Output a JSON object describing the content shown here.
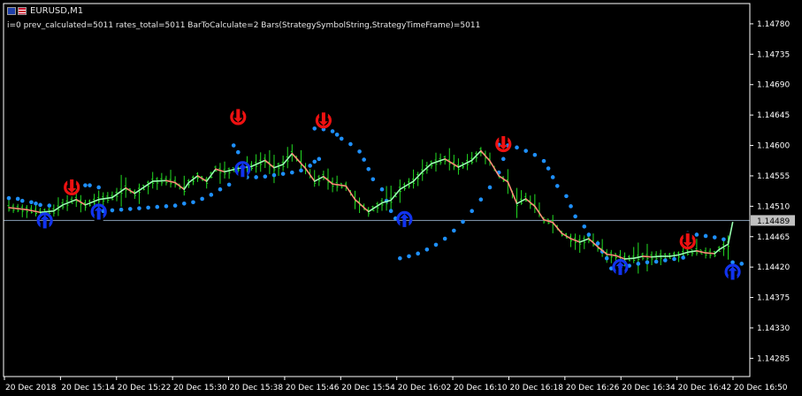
{
  "window": {
    "symbol_title": "EURUSD,M1",
    "info_line": "i=0 prev_calculated=5011 rates_total=5011 BarToCalculate=2 Bars(StrategySymbolString,StrategyTimeFrame)=5011"
  },
  "colors": {
    "background": "#000000",
    "axis": "#ffffff",
    "candle": "#22dd22",
    "line_up": "#98ffb0",
    "line_down": "#fa8f77",
    "dots": "#1e90ff",
    "arrow_down": "#ee1111",
    "arrow_up": "#1133ee",
    "price_line": "#8aa0b8",
    "price_tag_bg": "#c0c0c0"
  },
  "chart_data": {
    "type": "line",
    "symbol": "EURUSD",
    "timeframe": "M1",
    "y_ticks": [
      "1.14780",
      "1.14735",
      "1.14690",
      "1.14645",
      "1.14600",
      "1.14555",
      "1.14510",
      "1.14465",
      "1.14420",
      "1.14375",
      "1.14330",
      "1.14285"
    ],
    "x_ticks": [
      "20 Dec 2018",
      "20 Dec 15:14",
      "20 Dec 15:22",
      "20 Dec 15:30",
      "20 Dec 15:38",
      "20 Dec 15:46",
      "20 Dec 15:54",
      "20 Dec 16:02",
      "20 Dec 16:10",
      "20 Dec 16:18",
      "20 Dec 16:26",
      "20 Dec 16:34",
      "20 Dec 16:42",
      "20 Dec 16:50"
    ],
    "ylim": [
      1.14258,
      1.1481
    ],
    "current_price": "1.14489",
    "current_price_value": 1.14489,
    "x_range_bars": [
      0,
      112
    ],
    "series": [
      {
        "name": "",
        "color_up": "#98ffb0",
        "color_down": "#fa8f77",
        "points": [
          [
            0,
            1.14508
          ],
          [
            4,
            1.14505
          ],
          [
            7,
            1.14501
          ],
          [
            10,
            1.14503
          ],
          [
            12,
            1.14512
          ],
          [
            15,
            1.1452
          ],
          [
            17,
            1.14512
          ],
          [
            20,
            1.1452
          ],
          [
            23,
            1.14523
          ],
          [
            26,
            1.14537
          ],
          [
            28,
            1.14529
          ],
          [
            30,
            1.14538
          ],
          [
            32,
            1.14547
          ],
          [
            35,
            1.14548
          ],
          [
            37,
            1.14545
          ],
          [
            39,
            1.14535
          ],
          [
            40,
            1.14545
          ],
          [
            42,
            1.14555
          ],
          [
            44,
            1.14547
          ],
          [
            46,
            1.14565
          ],
          [
            48,
            1.14561
          ],
          [
            51,
            1.14566
          ],
          [
            54,
            1.14569
          ],
          [
            57,
            1.14578
          ],
          [
            59,
            1.14567
          ],
          [
            61,
            1.14572
          ],
          [
            63,
            1.14588
          ],
          [
            66,
            1.14566
          ],
          [
            68,
            1.14547
          ],
          [
            70,
            1.14554
          ],
          [
            72,
            1.14543
          ],
          [
            75,
            1.1454
          ],
          [
            77,
            1.1452
          ],
          [
            80,
            1.14502
          ],
          [
            83,
            1.14515
          ],
          [
            85,
            1.14519
          ],
          [
            87,
            1.14535
          ],
          [
            90,
            1.14547
          ],
          [
            92,
            1.14561
          ],
          [
            94,
            1.14573
          ],
          [
            97,
            1.1458
          ],
          [
            100,
            1.14568
          ],
          [
            103,
            1.14578
          ],
          [
            105,
            1.14592
          ],
          [
            107,
            1.14577
          ],
          [
            109,
            1.14555
          ],
          [
            111,
            1.14546
          ],
          [
            113,
            1.14514
          ],
          [
            115,
            1.14521
          ],
          [
            117,
            1.1451
          ],
          [
            119,
            1.1449
          ],
          [
            121,
            1.14486
          ],
          [
            123,
            1.1447
          ],
          [
            125,
            1.14462
          ],
          [
            127,
            1.14457
          ],
          [
            129,
            1.14462
          ],
          [
            131,
            1.1445
          ],
          [
            133,
            1.14439
          ],
          [
            135,
            1.14437
          ],
          [
            137,
            1.14432
          ],
          [
            139,
            1.14433
          ],
          [
            141,
            1.14436
          ],
          [
            143,
            1.14435
          ],
          [
            145,
            1.14436
          ],
          [
            147,
            1.14436
          ],
          [
            149,
            1.14438
          ],
          [
            151,
            1.14442
          ],
          [
            153,
            1.14444
          ],
          [
            155,
            1.14441
          ],
          [
            157,
            1.1444
          ],
          [
            158,
            1.14446
          ],
          [
            160,
            1.14454
          ],
          [
            161,
            1.14486
          ]
        ]
      }
    ],
    "dots_support": [
      [
        0,
        1.14522
      ],
      [
        2,
        1.14521
      ],
      [
        3,
        1.14518
      ],
      [
        5,
        1.14516
      ],
      [
        6,
        1.14514
      ],
      [
        7,
        1.14512
      ],
      [
        9,
        1.14511
      ],
      [
        17,
        1.14541
      ],
      [
        18,
        1.14541
      ],
      [
        20,
        1.14538
      ],
      [
        21,
        1.14503
      ],
      [
        23,
        1.14504
      ],
      [
        25,
        1.14505
      ],
      [
        27,
        1.14506
      ],
      [
        29,
        1.14507
      ],
      [
        31,
        1.14508
      ],
      [
        33,
        1.14509
      ],
      [
        35,
        1.1451
      ],
      [
        37,
        1.14511
      ],
      [
        39,
        1.14514
      ],
      [
        41,
        1.14516
      ],
      [
        43,
        1.14521
      ],
      [
        45,
        1.14527
      ],
      [
        47,
        1.14535
      ],
      [
        49,
        1.14542
      ],
      [
        50,
        1.146
      ],
      [
        51,
        1.1459
      ],
      [
        53,
        1.14553
      ],
      [
        55,
        1.14553
      ],
      [
        57,
        1.14554
      ],
      [
        59,
        1.14556
      ],
      [
        61,
        1.14558
      ],
      [
        63,
        1.1456
      ],
      [
        65,
        1.14563
      ],
      [
        67,
        1.1457
      ],
      [
        68,
        1.14576
      ],
      [
        69,
        1.1458
      ],
      [
        87,
        1.14433
      ],
      [
        89,
        1.14436
      ],
      [
        91,
        1.1444
      ],
      [
        93,
        1.14446
      ],
      [
        95,
        1.14453
      ],
      [
        97,
        1.14462
      ],
      [
        99,
        1.14474
      ],
      [
        101,
        1.14487
      ],
      [
        103,
        1.14503
      ],
      [
        105,
        1.1452
      ],
      [
        107,
        1.14538
      ],
      [
        109,
        1.1456
      ],
      [
        110,
        1.1458
      ],
      [
        134,
        1.14418
      ],
      [
        136,
        1.1442
      ],
      [
        138,
        1.14422
      ],
      [
        140,
        1.14425
      ],
      [
        142,
        1.14427
      ],
      [
        144,
        1.14428
      ],
      [
        146,
        1.1443
      ],
      [
        148,
        1.14432
      ],
      [
        150,
        1.14434
      ],
      [
        151,
        1.1447
      ],
      [
        153,
        1.14468
      ],
      [
        155,
        1.14466
      ],
      [
        157,
        1.14464
      ],
      [
        159,
        1.14461
      ],
      [
        161,
        1.14427
      ],
      [
        163,
        1.14425
      ]
    ],
    "dots_resistance": [
      [
        68,
        1.14625
      ],
      [
        70,
        1.14624
      ],
      [
        72,
        1.14621
      ],
      [
        73,
        1.14616
      ],
      [
        74,
        1.1461
      ],
      [
        76,
        1.14602
      ],
      [
        78,
        1.14591
      ],
      [
        79,
        1.14579
      ],
      [
        80,
        1.14565
      ],
      [
        81,
        1.1455
      ],
      [
        83,
        1.14535
      ],
      [
        84,
        1.14518
      ],
      [
        85,
        1.14503
      ],
      [
        86,
        1.14492
      ],
      [
        109,
        1.14601
      ],
      [
        111,
        1.146
      ],
      [
        113,
        1.14597
      ],
      [
        115,
        1.14592
      ],
      [
        117,
        1.14586
      ],
      [
        119,
        1.14577
      ],
      [
        120,
        1.14566
      ],
      [
        121,
        1.14553
      ],
      [
        122,
        1.1454
      ],
      [
        124,
        1.14525
      ],
      [
        125,
        1.1451
      ],
      [
        126,
        1.14495
      ],
      [
        128,
        1.1448
      ],
      [
        129,
        1.14468
      ],
      [
        131,
        1.14455
      ],
      [
        132,
        1.14443
      ],
      [
        133,
        1.14433
      ]
    ],
    "arrows": [
      {
        "x": 8,
        "y": 1.14489,
        "dir": "up"
      },
      {
        "x": 14,
        "y": 1.14538,
        "dir": "down"
      },
      {
        "x": 20,
        "y": 1.14502,
        "dir": "up"
      },
      {
        "x": 51,
        "y": 1.14642,
        "dir": "down"
      },
      {
        "x": 52,
        "y": 1.14565,
        "dir": "up"
      },
      {
        "x": 70,
        "y": 1.14637,
        "dir": "down"
      },
      {
        "x": 88,
        "y": 1.14491,
        "dir": "up"
      },
      {
        "x": 110,
        "y": 1.14602,
        "dir": "down"
      },
      {
        "x": 136,
        "y": 1.1442,
        "dir": "up"
      },
      {
        "x": 151,
        "y": 1.14458,
        "dir": "down"
      },
      {
        "x": 161,
        "y": 1.14413,
        "dir": "up"
      }
    ]
  }
}
